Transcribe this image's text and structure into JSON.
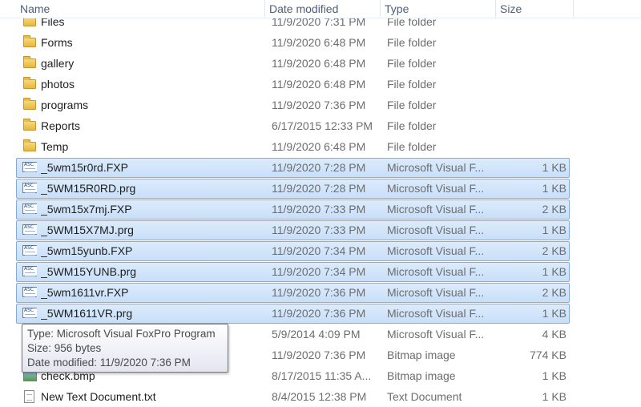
{
  "columns": {
    "name": "Name",
    "date_modified": "Date modified",
    "type": "Type",
    "size": "Size"
  },
  "rows": [
    {
      "icon": "folder-icon",
      "name": "Files",
      "date": "11/9/2020 7:31 PM",
      "type": "File folder",
      "size": "",
      "selected": false
    },
    {
      "icon": "folder-icon",
      "name": "Forms",
      "date": "11/9/2020 6:48 PM",
      "type": "File folder",
      "size": "",
      "selected": false
    },
    {
      "icon": "folder-icon",
      "name": "gallery",
      "date": "11/9/2020 6:48 PM",
      "type": "File folder",
      "size": "",
      "selected": false
    },
    {
      "icon": "folder-icon",
      "name": "photos",
      "date": "11/9/2020 6:48 PM",
      "type": "File folder",
      "size": "",
      "selected": false
    },
    {
      "icon": "folder-icon",
      "name": "programs",
      "date": "11/9/2020 7:36 PM",
      "type": "File folder",
      "size": "",
      "selected": false
    },
    {
      "icon": "folder-icon",
      "name": "Reports",
      "date": "6/17/2015 12:33 PM",
      "type": "File folder",
      "size": "",
      "selected": false
    },
    {
      "icon": "folder-icon",
      "name": "Temp",
      "date": "11/9/2020 6:48 PM",
      "type": "File folder",
      "size": "",
      "selected": false
    },
    {
      "icon": "program-file-icon",
      "name": "_5wm15r0rd.FXP",
      "date": "11/9/2020 7:28 PM",
      "type": "Microsoft Visual F...",
      "size": "1 KB",
      "selected": true
    },
    {
      "icon": "program-file-icon",
      "name": "_5WM15R0RD.prg",
      "date": "11/9/2020 7:28 PM",
      "type": "Microsoft Visual F...",
      "size": "1 KB",
      "selected": true
    },
    {
      "icon": "program-file-icon",
      "name": "_5wm15x7mj.FXP",
      "date": "11/9/2020 7:33 PM",
      "type": "Microsoft Visual F...",
      "size": "2 KB",
      "selected": true
    },
    {
      "icon": "program-file-icon",
      "name": "_5WM15X7MJ.prg",
      "date": "11/9/2020 7:33 PM",
      "type": "Microsoft Visual F...",
      "size": "1 KB",
      "selected": true
    },
    {
      "icon": "program-file-icon",
      "name": "_5wm15yunb.FXP",
      "date": "11/9/2020 7:34 PM",
      "type": "Microsoft Visual F...",
      "size": "2 KB",
      "selected": true
    },
    {
      "icon": "program-file-icon",
      "name": "_5WM15YUNB.prg",
      "date": "11/9/2020 7:34 PM",
      "type": "Microsoft Visual F...",
      "size": "1 KB",
      "selected": true
    },
    {
      "icon": "program-file-icon",
      "name": "_5wm1611vr.FXP",
      "date": "11/9/2020 7:36 PM",
      "type": "Microsoft Visual F...",
      "size": "2 KB",
      "selected": true
    },
    {
      "icon": "program-file-icon",
      "name": "_5WM1611VR.prg",
      "date": "11/9/2020 7:36 PM",
      "type": "Microsoft Visual F...",
      "size": "1 KB",
      "selected": true
    },
    {
      "icon": "program-file-icon",
      "name": "",
      "date": "5/9/2014 4:09 PM",
      "type": "Microsoft Visual F...",
      "size": "4 KB",
      "selected": false
    },
    {
      "icon": "bitmap-file-icon",
      "name": "",
      "date": "11/9/2020 7:36 PM",
      "type": "Bitmap image",
      "size": "774 KB",
      "selected": false
    },
    {
      "icon": "bitmap-file-icon",
      "name": "check.bmp",
      "date": "8/17/2015 11:35 A...",
      "type": "Bitmap image",
      "size": "1 KB",
      "selected": false
    },
    {
      "icon": "text-file-icon",
      "name": "New Text Document.txt",
      "date": "8/4/2015 12:38 PM",
      "type": "Text Document",
      "size": "1 KB",
      "selected": false
    }
  ],
  "tooltip": {
    "type_line": "Type: Microsoft Visual FoxPro Program",
    "size_line": "Size: 956 bytes",
    "date_line": "Date modified: 11/9/2020 7:36 PM"
  },
  "colors": {
    "selection_fill": "#cce0f8",
    "selection_border": "#84acdd",
    "header_text": "#4c607a"
  }
}
